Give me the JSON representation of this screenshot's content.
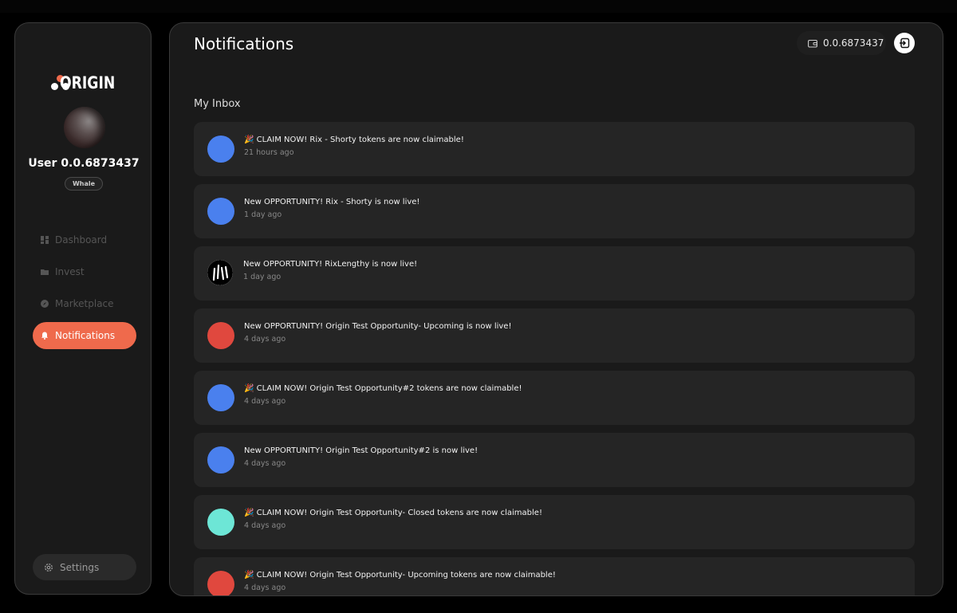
{
  "brand": {
    "name": "ORIGIN"
  },
  "user": {
    "name": "User 0.0.6873437",
    "tier": "Whale"
  },
  "nav": {
    "items": [
      {
        "label": "Dashboard",
        "icon": "grid-icon",
        "active": false
      },
      {
        "label": "Invest",
        "icon": "folder-icon",
        "active": false
      },
      {
        "label": "Marketplace",
        "icon": "compass-icon",
        "active": false
      },
      {
        "label": "Notifications",
        "icon": "bell-icon",
        "active": true
      }
    ],
    "settings_label": "Settings"
  },
  "header": {
    "title": "Notifications",
    "wallet_balance": "0.0.6873437"
  },
  "inbox": {
    "title": "My Inbox",
    "notifications": [
      {
        "title": "🎉 CLAIM NOW! Rix - Shorty tokens are now claimable!",
        "time": "21 hours ago",
        "icon_color": "#4a80ee"
      },
      {
        "title": "New OPPORTUNITY! Rix - Shorty is now live!",
        "time": "1 day ago",
        "icon_color": "#4a80ee"
      },
      {
        "title": "New OPPORTUNITY! RixLengthy is now live!",
        "time": "1 day ago",
        "icon_color": "#ffffff"
      },
      {
        "title": "New OPPORTUNITY! Origin Test Opportunity- Upcoming is now live!",
        "time": "4 days ago",
        "icon_color": "#e0483e"
      },
      {
        "title": "🎉 CLAIM NOW! Origin Test Opportunity#2 tokens are now claimable!",
        "time": "4 days ago",
        "icon_color": "#4a80ee"
      },
      {
        "title": "New OPPORTUNITY! Origin Test Opportunity#2 is now live!",
        "time": "4 days ago",
        "icon_color": "#4a80ee"
      },
      {
        "title": "🎉 CLAIM NOW! Origin Test Opportunity- Closed tokens are now claimable!",
        "time": "4 days ago",
        "icon_color": "#6de6d6"
      },
      {
        "title": "🎉 CLAIM NOW! Origin Test Opportunity- Upcoming tokens are now claimable!",
        "time": "4 days ago",
        "icon_color": "#e0483e"
      }
    ]
  },
  "colors": {
    "accent": "#ef6a4c",
    "panel": "#1a1a1a",
    "card": "#252525"
  }
}
